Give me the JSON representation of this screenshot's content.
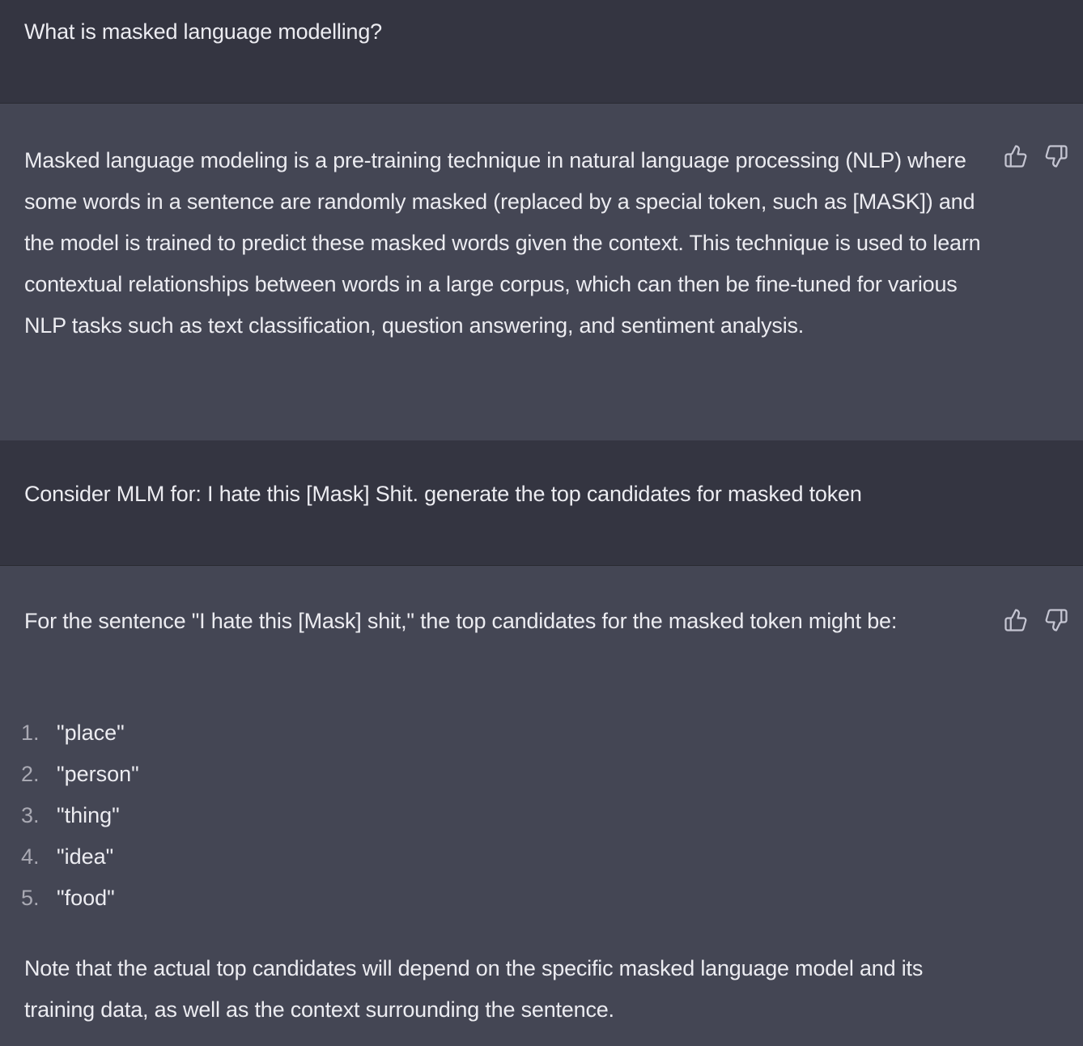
{
  "conversation": {
    "messages": [
      {
        "role": "user",
        "text": "What is masked language modelling?"
      },
      {
        "role": "assistant",
        "text": "Masked language modeling is a pre-training technique in natural language processing (NLP) where some words in a sentence are randomly masked (replaced by a special token, such as [MASK]) and the model is trained to predict these masked words given the context. This technique is used to learn contextual relationships between words in a large corpus, which can then be fine-tuned for various NLP tasks such as text classification, question answering, and sentiment analysis."
      },
      {
        "role": "user",
        "text": "Consider MLM for: I hate this [Mask] Shit. generate the top candidates for masked token"
      },
      {
        "role": "assistant",
        "intro": "For the sentence \"I hate this [Mask] shit,\" the top candidates for the masked token might be:",
        "list": [
          {
            "num": "1.",
            "text": "\"place\""
          },
          {
            "num": "2.",
            "text": "\"person\""
          },
          {
            "num": "3.",
            "text": "\"thing\""
          },
          {
            "num": "4.",
            "text": "\"idea\""
          },
          {
            "num": "5.",
            "text": "\"food\""
          }
        ],
        "outro": "Note that the actual top candidates will depend on the specific masked language model and its training data, as well as the context surrounding the sentence."
      }
    ]
  },
  "icons": {
    "thumbs_up": "thumbs-up-icon",
    "thumbs_down": "thumbs-down-icon"
  },
  "colors": {
    "user_bg": "#343541",
    "assistant_bg": "#444654",
    "text": "#ececf1",
    "list_number": "#a9a9b3",
    "icon": "#c5c5d2"
  }
}
